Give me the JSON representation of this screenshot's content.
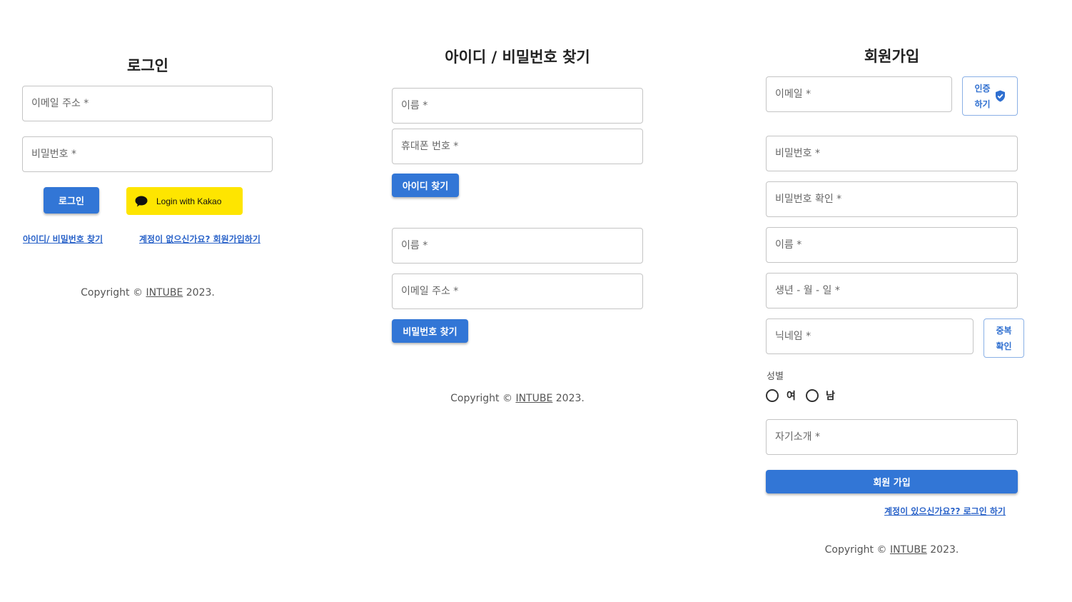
{
  "login": {
    "title": "로그인",
    "email_placeholder": "이메일 주소 *",
    "password_placeholder": "비밀번호 *",
    "login_button": "로그인",
    "kakao_button": "Login with Kakao",
    "find_link": "아이디/ 비밀번호 찾기",
    "signup_link": "계정이 없으신가요? 회원가입하기",
    "copyright_prefix": "Copyright © ",
    "copyright_brand": "INTUBE",
    "copyright_suffix": " 2023."
  },
  "find": {
    "title": "아이디 / 비밀번호 찾기",
    "id_name_placeholder": "이름 *",
    "phone_placeholder": "휴대폰 번호 *",
    "find_id_button": "아이디 찾기",
    "pw_name_placeholder": "이름 *",
    "pw_email_placeholder": "이메일 주소 *",
    "find_pw_button": "비밀번호 찾기",
    "copyright_prefix": "Copyright © ",
    "copyright_brand": "INTUBE",
    "copyright_suffix": " 2023."
  },
  "signup": {
    "title": "회원가입",
    "email_placeholder": "이메일 *",
    "verify_button_line1": "인증",
    "verify_button_line2": "하기",
    "password_placeholder": "비밀번호 *",
    "password_confirm_placeholder": "비밀번호 확인 *",
    "name_placeholder": "이름 *",
    "birth_placeholder": "생년 - 월 - 일 *",
    "nickname_placeholder": "닉네임 *",
    "dup_button_line1": "중복",
    "dup_button_line2": "확인",
    "gender_label": "성별",
    "gender_female": "여",
    "gender_male": "남",
    "intro_placeholder": "자기소개 *",
    "submit_button": "회원 가입",
    "login_link": "계정이 있으신가요?? 로그인 하기",
    "copyright_prefix": "Copyright © ",
    "copyright_brand": "INTUBE",
    "copyright_suffix": " 2023."
  },
  "colors": {
    "primary": "#3276d6",
    "kakao": "#fee500",
    "link": "#2a63c9"
  }
}
